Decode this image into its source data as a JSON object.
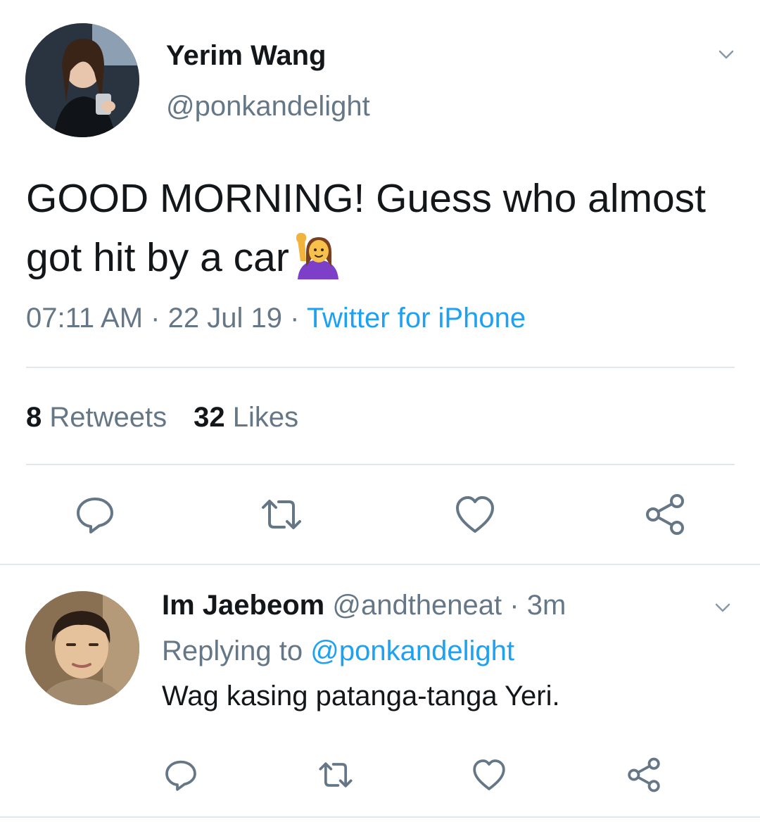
{
  "tweet": {
    "author_name": "Yerim Wang",
    "author_handle": "@ponkandelight",
    "text": "GOOD MORNING! Guess who almost got hit by a car",
    "emoji": "person-raising-hand",
    "time": "07:11 AM",
    "date": "22 Jul 19",
    "separator": "·",
    "source": "Twitter for iPhone",
    "retweets_count": "8",
    "retweets_label": "Retweets",
    "likes_count": "32",
    "likes_label": "Likes"
  },
  "reply": {
    "author_name": "Im Jaebeom",
    "author_handle": "@andtheneat",
    "separator": "·",
    "time": "3m",
    "replying_label": "Replying to",
    "replying_to": "@ponkandelight",
    "text": "Wag kasing patanga-tanga Yeri."
  },
  "icons": {
    "reply": "reply-bubble-icon",
    "retweet": "retweet-icon",
    "like": "heart-icon",
    "share": "share-icon",
    "menu": "chevron-down-icon"
  },
  "colors": {
    "text": "#14171a",
    "secondary": "#657786",
    "link": "#1da1f2",
    "divider": "#e1e8ed"
  }
}
